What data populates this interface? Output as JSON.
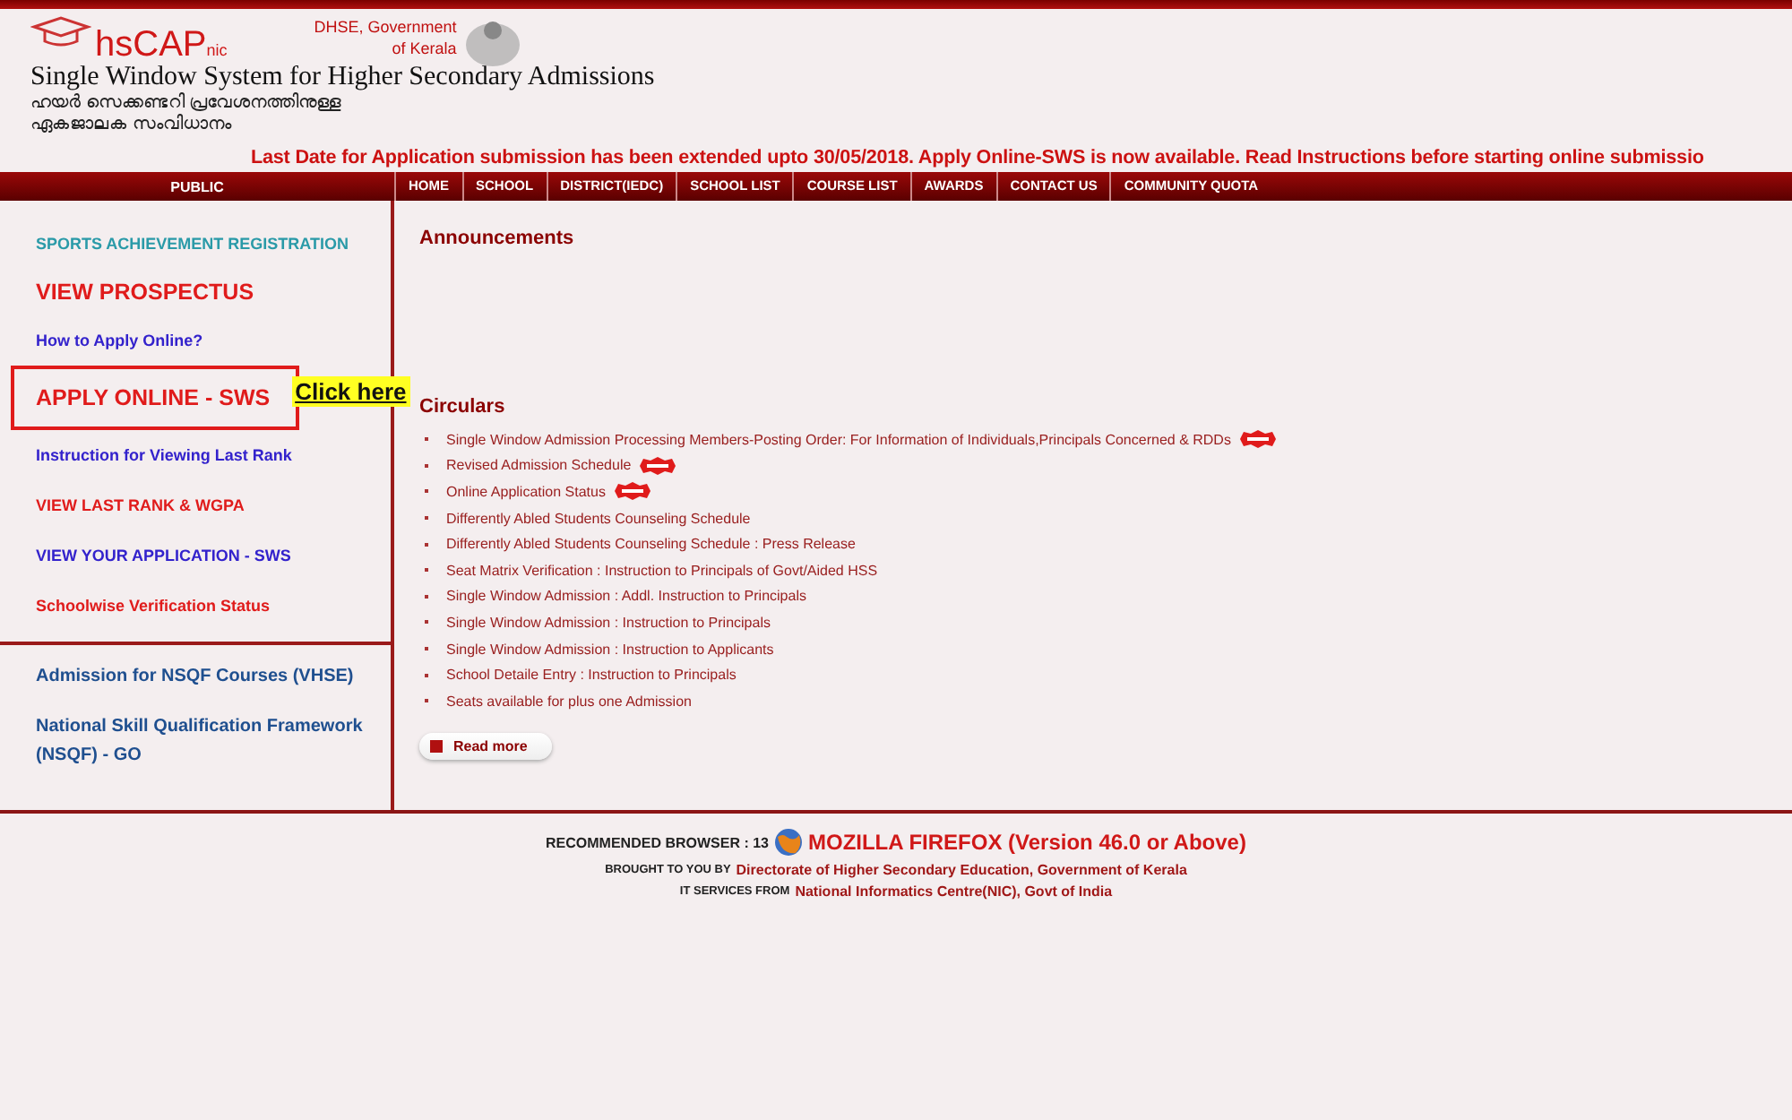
{
  "header": {
    "logo_text": "hsCAP",
    "logo_sub": "nic",
    "agency": "DHSE, Government of Kerala",
    "title": "Single Window System for Higher Secondary Admissions",
    "subtitle_lines": [
      "ഹയർ സെക്കണ്ടറി പ്രവേശനത്തിനുള്ള",
      "ഏകജാലക സംവിധാനം"
    ]
  },
  "ticker": "Last Date for Application submission has been extended upto 30/05/2018. Apply Online-SWS is now available. Read Instructions before starting online submissio",
  "sidebar_title": "PUBLIC",
  "nav": [
    "HOME",
    "SCHOOL",
    "DISTRICT(IEDC)",
    "SCHOOL LIST",
    "COURSE LIST",
    "AWARDS",
    "CONTACT US",
    "COMMUNITY QUOTA"
  ],
  "sidebar": {
    "items": [
      {
        "label": "SPORTS ACHIEVEMENT REGISTRATION",
        "color": "#2a9aa8",
        "kind": "small",
        "highlighted": false
      },
      {
        "label": "VIEW PROSPECTUS",
        "color": "#e01b1b",
        "kind": "large",
        "highlighted": false
      },
      {
        "label": "How to Apply Online?",
        "color": "#3322cc",
        "kind": "small",
        "highlighted": false
      },
      {
        "label": "APPLY ONLINE - SWS",
        "color": "#e01b1b",
        "kind": "large",
        "highlighted": true,
        "callout": "Click here"
      },
      {
        "label": "Instruction for Viewing Last Rank",
        "color": "#3322cc",
        "kind": "small",
        "highlighted": false
      },
      {
        "label": "VIEW LAST RANK & WGPA",
        "color": "#e01b1b",
        "kind": "small",
        "highlighted": false
      },
      {
        "label": "VIEW YOUR APPLICATION - SWS",
        "color": "#3322cc",
        "kind": "small",
        "highlighted": false
      },
      {
        "label": "Schoolwise Verification Status",
        "color": "#e01b1b",
        "kind": "small",
        "highlighted": false
      }
    ],
    "lower_items": [
      "Admission for NSQF Courses (VHSE)",
      "National Skill Qualification Framework (NSQF) - GO"
    ]
  },
  "announcements": {
    "title": "Announcements"
  },
  "circulars": {
    "title": "Circulars",
    "items": [
      {
        "text": "Single Window Admission Processing Members-Posting Order: For Information of Individuals,Principals Concerned & RDDs",
        "new": true
      },
      {
        "text": "Revised Admission Schedule",
        "new": true
      },
      {
        "text": "Online Application Status",
        "new": true
      },
      {
        "text": "Differently Abled Students Counseling Schedule",
        "new": false
      },
      {
        "text": "Differently Abled Students Counseling Schedule : Press Release",
        "new": false
      },
      {
        "text": "Seat Matrix Verification : Instruction to Principals of Govt/Aided HSS",
        "new": false
      },
      {
        "text": "Single Window Admission : Addl. Instruction to Principals",
        "new": false
      },
      {
        "text": "Single Window Admission : Instruction to Principals",
        "new": false
      },
      {
        "text": "Single Window Admission : Instruction to Applicants",
        "new": false
      },
      {
        "text": "School Detaile Entry : Instruction to Principals",
        "new": false
      },
      {
        "text": "Seats available for plus one Admission",
        "new": false
      }
    ],
    "read_more": "Read more"
  },
  "footer": {
    "browser_label": "RECOMMENDED BROWSER : 13",
    "browser": "MOZILLA FIREFOX (Version 46.0 or Above)",
    "brought_label": "BROUGHT TO YOU BY",
    "brought": "Directorate of Higher Secondary Education, Government of Kerala",
    "it_label": "IT SERVICES FROM",
    "it": "National Informatics Centre(NIC), Govt of India"
  }
}
